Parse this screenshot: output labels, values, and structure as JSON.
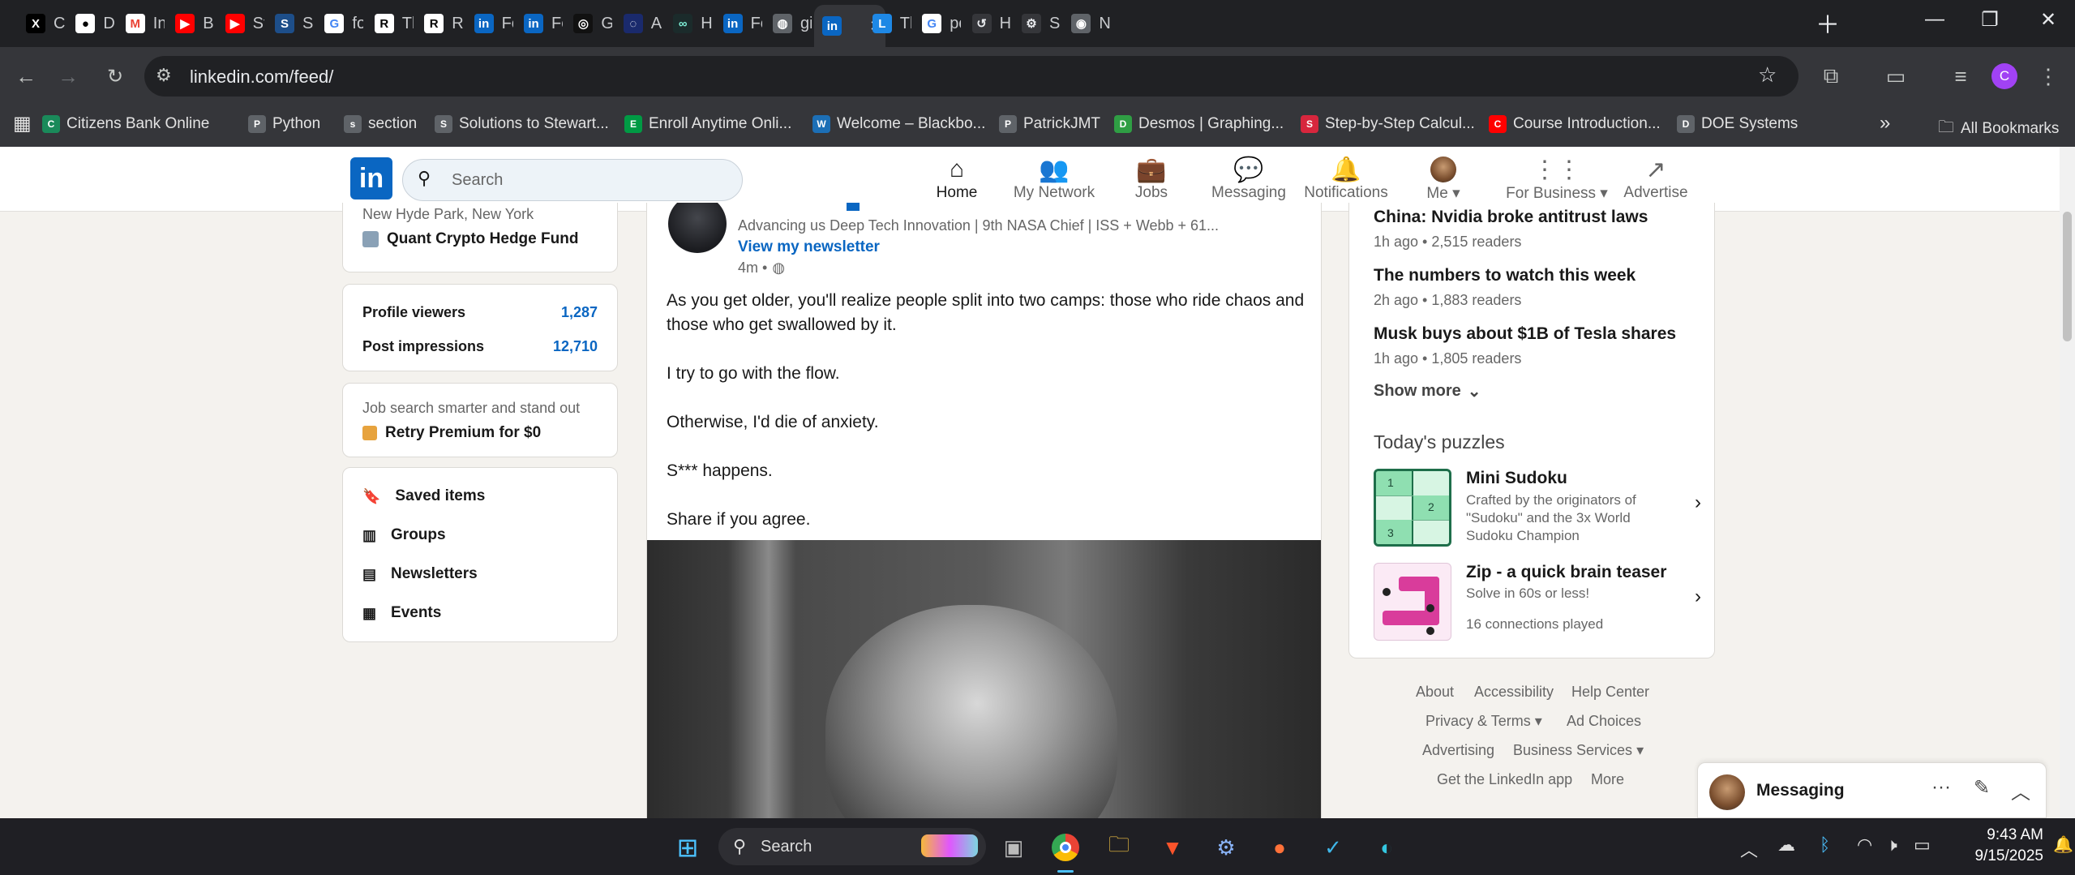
{
  "tabs": [
    {
      "label": "Calv",
      "icon": "x-icon"
    },
    {
      "label": "Dep",
      "icon": "github-icon"
    },
    {
      "label": "Inbo",
      "icon": "gmail-icon"
    },
    {
      "label": "Big",
      "icon": "youtube-icon"
    },
    {
      "label": "Stev",
      "icon": "youtube-icon"
    },
    {
      "label": "Sea",
      "icon": "ssrn-icon"
    },
    {
      "label": "foru",
      "icon": "google-icon"
    },
    {
      "label": "The",
      "icon": "researchgate-icon"
    },
    {
      "label": "Res",
      "icon": "researchgate-icon"
    },
    {
      "label": "Fee",
      "icon": "linkedin-icon"
    },
    {
      "label": "Fee",
      "icon": "linkedin-icon"
    },
    {
      "label": "Gra",
      "icon": "openai-icon"
    },
    {
      "label": "Alte",
      "icon": "alteryx-icon"
    },
    {
      "label": "Hyp",
      "icon": "hyperliquid-icon"
    },
    {
      "label": "Fee",
      "icon": "linkedin-icon"
    },
    {
      "label": "gith",
      "icon": "globe-icon"
    },
    {
      "label": "",
      "icon": "linkedin-icon"
    },
    {
      "label": "The",
      "icon": "bookmark-site-icon"
    },
    {
      "label": "poly",
      "icon": "google-icon"
    },
    {
      "label": "Hist",
      "icon": "history-icon"
    },
    {
      "label": "Sett",
      "icon": "gear-icon"
    },
    {
      "label": "Nev",
      "icon": "chrome-icon"
    }
  ],
  "browser": {
    "url": "linkedin.com/feed/",
    "all_bookmarks": "All Bookmarks"
  },
  "bookmarks": [
    {
      "label": "Citizens Bank Online",
      "icon": "citizens-icon",
      "color": "#1a8a5a"
    },
    {
      "label": "Python",
      "icon": "folder-icon",
      "color": "#5f6368"
    },
    {
      "label": "section",
      "icon": "globe-icon",
      "color": "#5f6368"
    },
    {
      "label": "Solutions to Stewart...",
      "icon": "globe-icon",
      "color": "#5f6368"
    },
    {
      "label": "Enroll Anytime Onli...",
      "icon": "und-icon",
      "color": "#009a44"
    },
    {
      "label": "Welcome – Blackbo...",
      "icon": "blackboard-icon",
      "color": "#1c6fb6"
    },
    {
      "label": "PatrickJMT",
      "icon": "globe-icon",
      "color": "#5f6368"
    },
    {
      "label": "Desmos | Graphing...",
      "icon": "desmos-icon",
      "color": "#2f9e44"
    },
    {
      "label": "Step-by-Step Calcul...",
      "icon": "symbolab-icon",
      "color": "#d7263d"
    },
    {
      "label": "Course Introduction...",
      "icon": "youtube-icon",
      "color": "#ff0000"
    },
    {
      "label": "DOE Systems",
      "icon": "doe-icon",
      "color": "#5f6368"
    }
  ],
  "linkedin": {
    "search_placeholder": "Search",
    "nav": [
      {
        "label": "Home",
        "icon": "home-icon"
      },
      {
        "label": "My Network",
        "icon": "network-icon"
      },
      {
        "label": "Jobs",
        "icon": "briefcase-icon"
      },
      {
        "label": "Messaging",
        "icon": "messaging-icon"
      },
      {
        "label": "Notifications",
        "icon": "bell-icon"
      },
      {
        "label": "Me",
        "icon": "avatar-icon"
      },
      {
        "label": "For Business",
        "icon": "grid-icon"
      },
      {
        "label": "Advertise",
        "icon": "advertise-icon"
      }
    ],
    "profile": {
      "location": "New Hyde Park, New York",
      "company": "Quant Crypto Hedge Fund"
    },
    "stats": [
      {
        "label": "Profile viewers",
        "value": "1,287"
      },
      {
        "label": "Post impressions",
        "value": "12,710"
      }
    ],
    "premium": {
      "teaser": "Job search smarter and stand out",
      "cta": "Retry Premium for $0"
    },
    "left_links": [
      {
        "label": "Saved items",
        "icon": "bookmark-icon"
      },
      {
        "label": "Groups",
        "icon": "groups-icon"
      },
      {
        "label": "Newsletters",
        "icon": "newsletter-icon"
      },
      {
        "label": "Events",
        "icon": "calendar-icon"
      }
    ],
    "post": {
      "headline": "Advancing us Deep Tech Innovation | 9th NASA Chief | ISS + Webb + 61...",
      "newsletter_link": "View my newsletter",
      "time": "4m •",
      "paragraphs": [
        "As you get older, you'll realize people split into two camps: those who ride chaos and those who get swallowed by it.",
        "I try to go with the flow.",
        "Otherwise, I'd die of anxiety.",
        "S*** happens.",
        "Share if you agree."
      ]
    },
    "news": [
      {
        "title": "China: Nvidia broke antitrust laws",
        "meta": "1h ago • 2,515 readers"
      },
      {
        "title": "The numbers to watch this week",
        "meta": "2h ago • 1,883 readers"
      },
      {
        "title": "Musk buys about $1B of Tesla shares",
        "meta": "1h ago • 1,805 readers"
      }
    ],
    "show_more": "Show more",
    "puzzles_title": "Today's puzzles",
    "puzzles": [
      {
        "title": "Mini Sudoku",
        "desc": "Crafted by the originators of \"Sudoku\" and the 3x World Sudoku Champion",
        "extra": ""
      },
      {
        "title": "Zip - a quick brain teaser",
        "desc": "Solve in 60s or less!",
        "extra": "16 connections played"
      }
    ],
    "sudoku_digits": [
      "1",
      "2",
      "3"
    ],
    "footer": {
      "row1": [
        "About",
        "Accessibility",
        "Help Center"
      ],
      "row2": [
        "Privacy & Terms",
        "Ad Choices"
      ],
      "row3": [
        "Advertising",
        "Business Services"
      ],
      "row4": [
        "Get the LinkedIn app",
        "More"
      ]
    },
    "messaging": "Messaging"
  },
  "taskbar": {
    "search": "Search",
    "time": "9:43 AM",
    "date": "9/15/2025"
  },
  "colors": {
    "linkedin_blue": "#0a66c2",
    "chrome_dark": "#202124",
    "toolbar": "#35363a"
  }
}
